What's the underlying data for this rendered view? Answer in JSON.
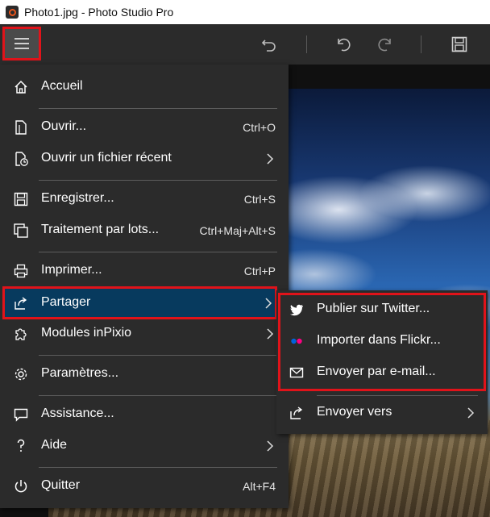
{
  "window": {
    "title": "Photo1.jpg - Photo Studio Pro"
  },
  "toolbar": {
    "icons": [
      "menu-icon",
      "rotate-left-icon",
      "undo-icon",
      "redo-icon",
      "save-icon"
    ]
  },
  "main_menu": {
    "items": [
      {
        "label": "Accueil",
        "icon": "home-icon",
        "shortcut": ""
      },
      {
        "label": "Ouvrir...",
        "icon": "open-file-icon",
        "shortcut": "Ctrl+O"
      },
      {
        "label": "Ouvrir un fichier récent",
        "icon": "recent-file-icon",
        "shortcut": ""
      },
      {
        "label": "Enregistrer...",
        "icon": "save-icon",
        "shortcut": "Ctrl+S"
      },
      {
        "label": "Traitement par lots...",
        "icon": "batch-icon",
        "shortcut": "Ctrl+Maj+Alt+S"
      },
      {
        "label": "Imprimer...",
        "icon": "print-icon",
        "shortcut": "Ctrl+P"
      },
      {
        "label": "Partager",
        "icon": "share-icon",
        "shortcut": ""
      },
      {
        "label": "Modules inPixio",
        "icon": "puzzle-icon",
        "shortcut": ""
      },
      {
        "label": "Paramètres...",
        "icon": "gear-icon",
        "shortcut": ""
      },
      {
        "label": "Assistance...",
        "icon": "chat-icon",
        "shortcut": ""
      },
      {
        "label": "Aide",
        "icon": "help-icon",
        "shortcut": ""
      },
      {
        "label": "Quitter",
        "icon": "power-icon",
        "shortcut": "Alt+F4"
      }
    ]
  },
  "share_menu": {
    "items": [
      {
        "label": "Publier sur Twitter...",
        "icon": "twitter-icon"
      },
      {
        "label": "Importer dans Flickr...",
        "icon": "flickr-icon"
      },
      {
        "label": "Envoyer par e-mail...",
        "icon": "mail-icon"
      },
      {
        "label": "Envoyer vers",
        "icon": "share-icon"
      }
    ]
  },
  "colors": {
    "menu_bg": "#2b2b2b",
    "highlight_bg": "#073a5e",
    "annotation_red": "#e0131a",
    "flickr_blue": "#0063dc",
    "flickr_pink": "#ff0084"
  }
}
